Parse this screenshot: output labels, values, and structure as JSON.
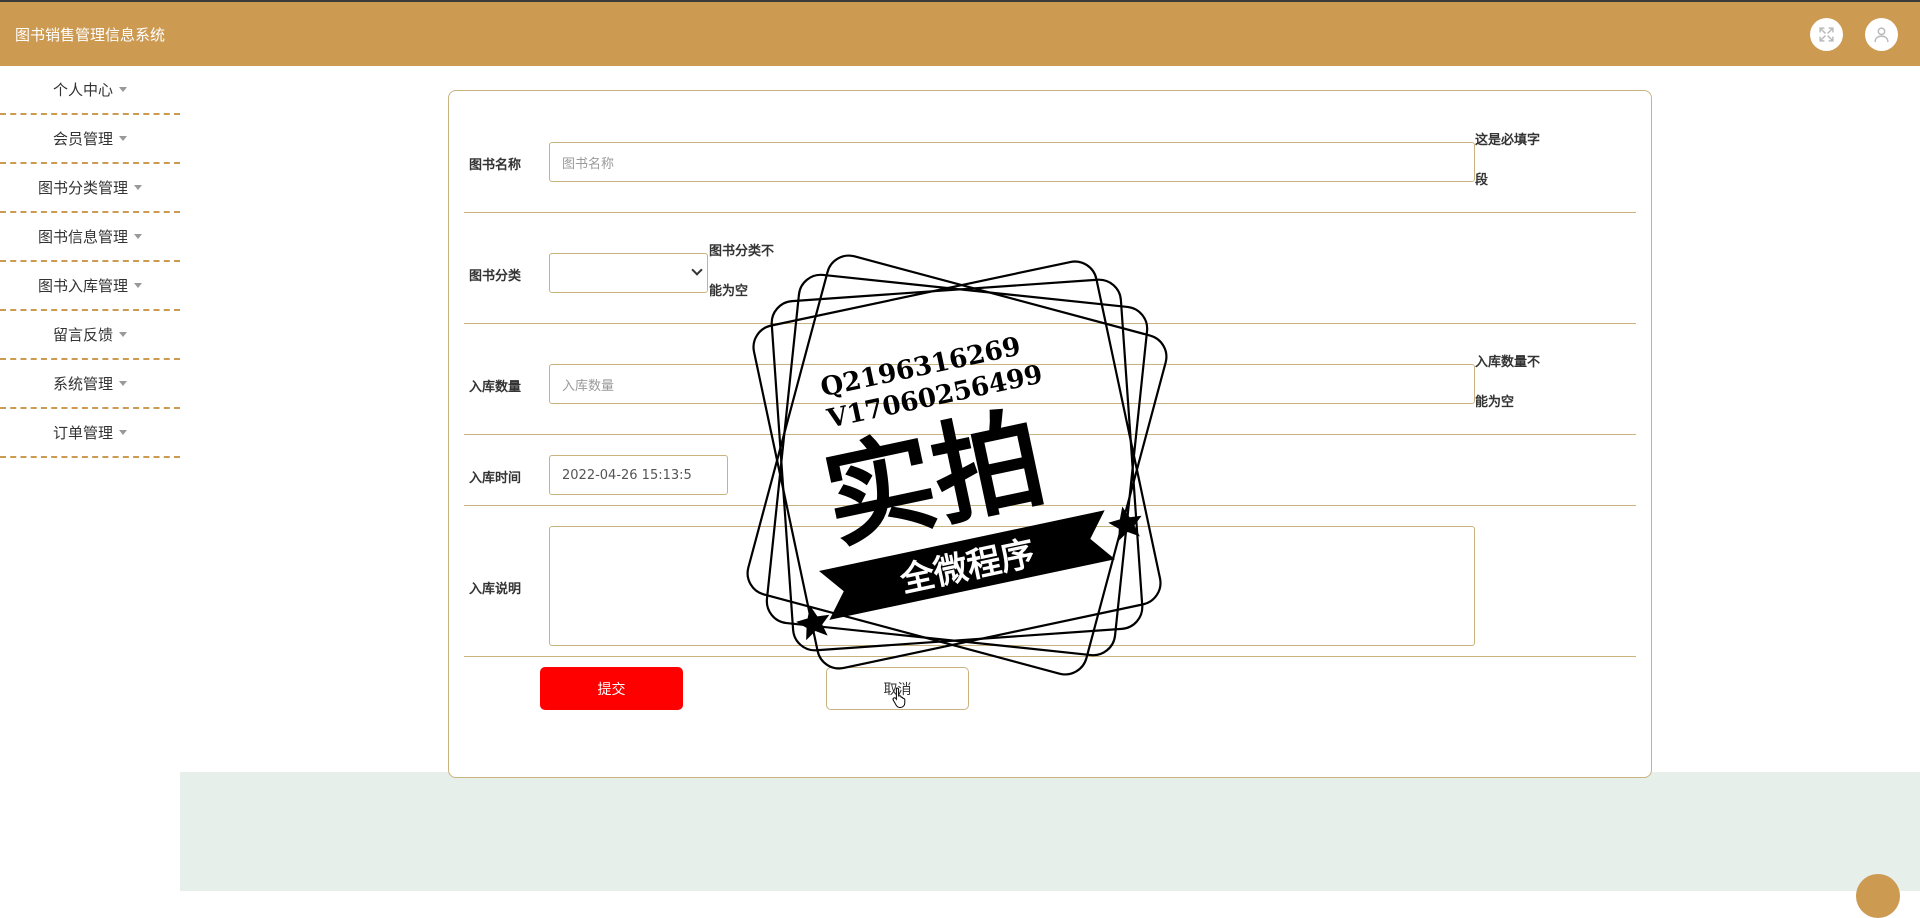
{
  "header": {
    "app_title": "图书销售管理信息系统",
    "icons": [
      "fullscreen-icon",
      "user-icon"
    ]
  },
  "sidebar": {
    "items": [
      {
        "label": "个人中心"
      },
      {
        "label": "会员管理"
      },
      {
        "label": "图书分类管理"
      },
      {
        "label": "图书信息管理"
      },
      {
        "label": "图书入库管理"
      },
      {
        "label": "留言反馈"
      },
      {
        "label": "系统管理"
      },
      {
        "label": "订单管理"
      }
    ]
  },
  "form": {
    "book_name": {
      "label": "图书名称",
      "placeholder": "图书名称",
      "error_line1": "这是必填字",
      "error_line2": "段"
    },
    "book_category": {
      "label": "图书分类",
      "value": "",
      "error_line1": "图书分类不",
      "error_line2": "能为空"
    },
    "stock_quantity": {
      "label": "入库数量",
      "placeholder": "入库数量",
      "error_line1": "入库数量不",
      "error_line2": "能为空"
    },
    "stock_time": {
      "label": "入库时间",
      "value": "2022-04-26 15:13:5"
    },
    "stock_note": {
      "label": "入库说明",
      "value": ""
    },
    "submit_label": "提交",
    "cancel_label": "取消"
  },
  "watermark": {
    "line1": "Q2196316269",
    "line2": "V17060256499",
    "main": "实拍",
    "ribbon": "全微程序"
  },
  "colors": {
    "header_bg": "#cc9a51",
    "submit_bg": "#ff0000",
    "bottom_band": "#e6efe9",
    "border": "#c9b37e"
  }
}
